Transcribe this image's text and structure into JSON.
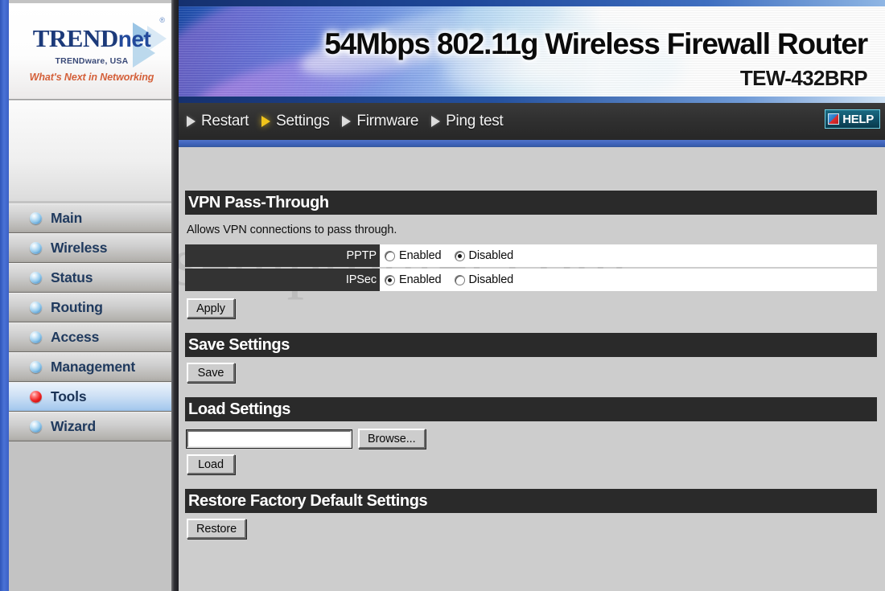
{
  "branding": {
    "logo_name": "TRENDnet",
    "logo_net": "net",
    "logo_reg": "®",
    "company": "TRENDware, USA",
    "tagline": "What's Next in Networking"
  },
  "banner": {
    "title": "54Mbps 802.11g Wireless Firewall Router",
    "model": "TEW-432BRP"
  },
  "nav": {
    "items": [
      {
        "label": "Restart",
        "active": false
      },
      {
        "label": "Settings",
        "active": true
      },
      {
        "label": "Firmware",
        "active": false
      },
      {
        "label": "Ping test",
        "active": false
      }
    ],
    "help_label": "HELP"
  },
  "sidebar": {
    "items": [
      {
        "label": "Main",
        "active": false
      },
      {
        "label": "Wireless",
        "active": false
      },
      {
        "label": "Status",
        "active": false
      },
      {
        "label": "Routing",
        "active": false
      },
      {
        "label": "Access",
        "active": false
      },
      {
        "label": "Management",
        "active": false
      },
      {
        "label": "Tools",
        "active": true
      },
      {
        "label": "Wizard",
        "active": false
      }
    ]
  },
  "watermark": "setuprouter.com",
  "main": {
    "vpn": {
      "title": "VPN Pass-Through",
      "description": "Allows VPN connections to pass through.",
      "rows": [
        {
          "label": "PPTP",
          "enabled_label": "Enabled",
          "disabled_label": "Disabled",
          "selected": "Disabled"
        },
        {
          "label": "IPSec",
          "enabled_label": "Enabled",
          "disabled_label": "Disabled",
          "selected": "Enabled"
        }
      ],
      "apply_label": "Apply"
    },
    "save": {
      "title": "Save Settings",
      "save_label": "Save"
    },
    "load": {
      "title": "Load Settings",
      "file_value": "",
      "browse_label": "Browse...",
      "load_label": "Load"
    },
    "restore": {
      "title": "Restore Factory Default Settings",
      "restore_label": "Restore"
    }
  },
  "colors": {
    "page_border_blue": "#3a60c6",
    "nav_blue_bar": "#3f63bb",
    "section_bar": "#2a2a2a",
    "row_label_bg": "#333333",
    "active_nav_arrow": "#f0c41b",
    "active_led": "#ee2020",
    "led": "#4b93c9",
    "content_bg": "#cdcdcd"
  }
}
